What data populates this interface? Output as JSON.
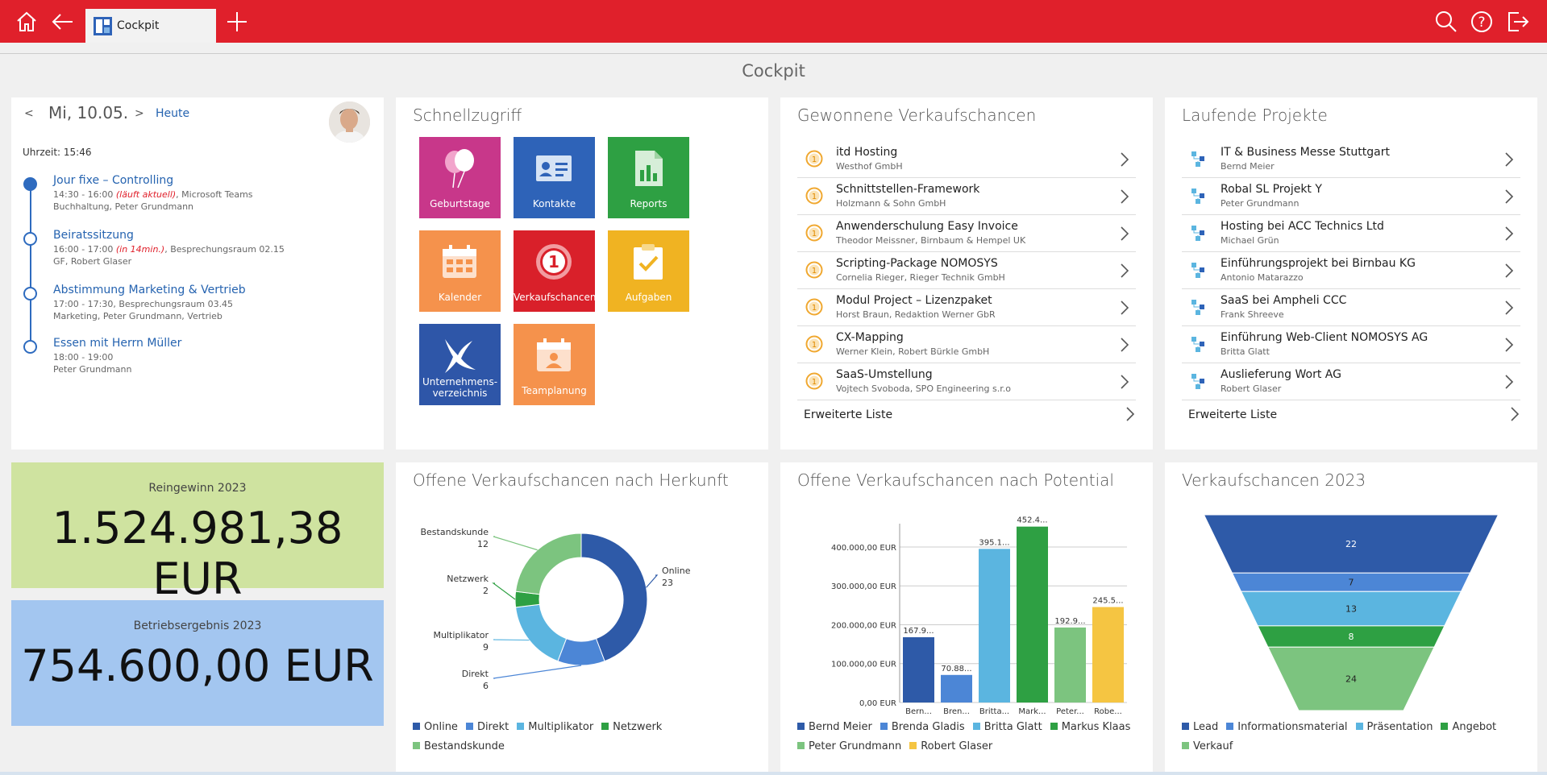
{
  "header": {
    "tab_label": "Cockpit",
    "page_title": "Cockpit"
  },
  "calendar": {
    "prev": "<",
    "date": "Mi, 10.05.",
    "next": ">",
    "today_label": "Heute",
    "time_label": "Uhrzeit: 15:46",
    "events": [
      {
        "title": "Jour fixe – Controlling",
        "time": "14:30 - 16:00 ",
        "status": "(läuft aktuell)",
        "location": ", Microsoft Teams",
        "people": "Buchhaltung, Peter Grundmann"
      },
      {
        "title": "Beiratssitzung",
        "time": "16:00 - 17:00 ",
        "status": "(in 14min.)",
        "location": ", Besprechungsraum 02.15",
        "people": "GF, Robert Glaser"
      },
      {
        "title": "Abstimmung Marketing & Vertrieb",
        "time": "17:00 - 17:30",
        "status": "",
        "location": ", Besprechungsraum 03.45",
        "people": "Marketing, Peter Grundmann, Vertrieb"
      },
      {
        "title": "Essen mit Herrn Müller",
        "time": "18:00 - 19:00",
        "status": "",
        "location": "",
        "people": "Peter Grundmann"
      }
    ]
  },
  "quick": {
    "title": "Schnellzugriff",
    "tiles": [
      {
        "label": "Geburtstage",
        "color": "#c8378a",
        "icon": "balloon-icon"
      },
      {
        "label": "Kontakte",
        "color": "#2e63b8",
        "icon": "contact-card-icon"
      },
      {
        "label": "Reports",
        "color": "#2ea043",
        "icon": "report-chart-icon"
      },
      {
        "label": "Kalender",
        "color": "#f5924c",
        "icon": "calendar-icon"
      },
      {
        "label": "Verkaufschancen",
        "color": "#d9202a",
        "icon": "opportunity-icon"
      },
      {
        "label": "Aufgaben",
        "color": "#f0b322",
        "icon": "tasks-icon"
      },
      {
        "label": "Unternehmens-",
        "label2": "verzeichnis",
        "color": "#2e56a8",
        "icon": "company-directory-icon"
      },
      {
        "label": "Teamplanung",
        "color": "#f5924c",
        "icon": "team-planning-icon"
      }
    ]
  },
  "won": {
    "title": "Gewonnene Verkaufschancen",
    "more": "Erweiterte Liste",
    "items": [
      {
        "title": "itd Hosting",
        "sub": "Westhof GmbH"
      },
      {
        "title": "Schnittstellen-Framework",
        "sub": "Holzmann & Sohn GmbH"
      },
      {
        "title": "Anwenderschulung Easy Invoice",
        "sub": "Theodor Meissner, Birnbaum & Hempel UK"
      },
      {
        "title": "Scripting-Package NOMOSYS",
        "sub": "Cornelia Rieger, Rieger Technik GmbH"
      },
      {
        "title": "Modul Project – Lizenzpaket",
        "sub": "Horst Braun, Redaktion Werner GbR"
      },
      {
        "title": "CX-Mapping",
        "sub": "Werner Klein, Robert Bürkle GmbH"
      },
      {
        "title": "SaaS-Umstellung",
        "sub": "Vojtech Svoboda, SPO Engineering s.r.o"
      }
    ]
  },
  "projects": {
    "title": "Laufende Projekte",
    "more": "Erweiterte Liste",
    "items": [
      {
        "title": "IT & Business Messe Stuttgart",
        "sub": "Bernd Meier"
      },
      {
        "title": "Robal SL Projekt Y",
        "sub": "Peter Grundmann"
      },
      {
        "title": "Hosting bei ACC Technics Ltd",
        "sub": "Michael Grün"
      },
      {
        "title": "Einführungsprojekt bei Birnbau KG",
        "sub": "Antonio Matarazzo"
      },
      {
        "title": "SaaS bei Ampheli CCC",
        "sub": "Frank Shreeve"
      },
      {
        "title": "Einführung Web-Client NOMOSYS AG",
        "sub": "Britta Glatt"
      },
      {
        "title": "Auslieferung Wort AG",
        "sub": "Robert Glaser"
      }
    ]
  },
  "kpi1": {
    "label": "Reingewinn 2023",
    "value": "1.524.981,38 EUR",
    "color": "#cfe3a0"
  },
  "kpi2": {
    "label": "Betriebsergebnis 2023",
    "value": "754.600,00 EUR",
    "color": "#a3c6f0"
  },
  "chart_data": [
    {
      "type": "pie",
      "title": "Offene Verkaufschancen nach Herkunft",
      "categories": [
        "Online",
        "Direkt",
        "Multiplikator",
        "Netzwerk",
        "Bestandskunde"
      ],
      "values": [
        23,
        6,
        9,
        2,
        12
      ],
      "colors": [
        "#2e5aa8",
        "#4c86d6",
        "#5bb5e0",
        "#2ea043",
        "#7cc47f"
      ]
    },
    {
      "type": "bar",
      "title": "Offene Verkaufschancen nach Potential",
      "categories": [
        "Bern...",
        "Bren...",
        "Britta...",
        "Mark...",
        "Peter...",
        "Robe..."
      ],
      "series": [
        {
          "name": "Bernd Meier",
          "values": [
            167900
          ]
        },
        {
          "name": "Brenda Gladis",
          "values": [
            70880
          ]
        },
        {
          "name": "Britta Glatt",
          "values": [
            395100
          ]
        },
        {
          "name": "Markus Klaas",
          "values": [
            452400
          ]
        },
        {
          "name": "Peter Grundmann",
          "values": [
            192900
          ]
        },
        {
          "name": "Robert Glaser",
          "values": [
            245500
          ]
        }
      ],
      "data_labels": [
        "167.9...",
        "70.88...",
        "395.1...",
        "452.4...",
        "192.9...",
        "245.5..."
      ],
      "yticks": [
        "0,00 EUR",
        "100.000,00 EUR",
        "200.000,00 EUR",
        "300.000,00 EUR",
        "400.000,00 EUR"
      ],
      "ylim": [
        0,
        460000
      ],
      "colors": [
        "#2e5aa8",
        "#4c86d6",
        "#5bb5e0",
        "#2ea043",
        "#7cc47f",
        "#f5c542"
      ]
    },
    {
      "type": "funnel",
      "title": "Verkaufschancen 2023",
      "categories": [
        "Lead",
        "Informationsmaterial",
        "Präsentation",
        "Angebot",
        "Verkauf"
      ],
      "values": [
        22,
        7,
        13,
        8,
        24
      ],
      "colors": [
        "#2e5aa8",
        "#4c86d6",
        "#5bb5e0",
        "#2ea043",
        "#7cc47f"
      ]
    }
  ]
}
